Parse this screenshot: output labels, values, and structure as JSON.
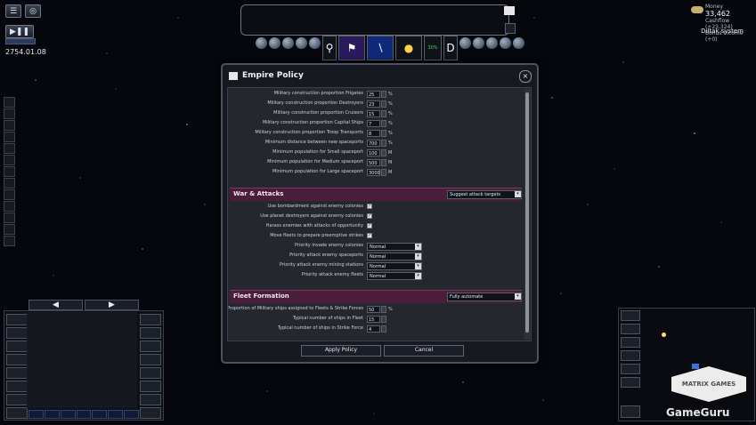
{
  "top_left": {
    "date": "2754.01.08",
    "play_symbol": "▶❚❚"
  },
  "top_right": {
    "money_label": "Money",
    "money_value": "33,462",
    "cashflow_label": "Cashflow",
    "cashflow_value": "(+23,324)",
    "bonus_label": "Bonus Income",
    "bonus_value": "(+0)",
    "system_name": "Diltak system"
  },
  "toolbar": {
    "research_label": "30%"
  },
  "dialog": {
    "title": "Empire Policy",
    "close_symbol": "×",
    "construction": [
      {
        "label": "Military construction proportion Frigates",
        "value": "25",
        "unit": "%"
      },
      {
        "label": "Military construction proportion Destroyers",
        "value": "23",
        "unit": "%"
      },
      {
        "label": "Military construction proportion Cruisers",
        "value": "15",
        "unit": "%"
      },
      {
        "label": "Military construction proportion Capital Ships",
        "value": "7",
        "unit": "%"
      },
      {
        "label": "Military construction proportion Troop Transports",
        "value": "8",
        "unit": "%"
      },
      {
        "label": "Minimum distance between new spaceports",
        "value": "700",
        "unit": "%"
      },
      {
        "label": "Minimum population for Small spaceport",
        "value": "100",
        "unit": "M"
      },
      {
        "label": "Minimum population for Medium spaceport",
        "value": "500",
        "unit": "M"
      },
      {
        "label": "Minimum population for Large spaceport",
        "value": "3000",
        "unit": "M"
      }
    ],
    "war": {
      "title": "War & Attacks",
      "select": "Suggest attack targets",
      "checks": [
        {
          "label": "Use bombardment against enemy colonies",
          "mark": "✓"
        },
        {
          "label": "Use planet destroyers against enemy colonies",
          "mark": "✓"
        },
        {
          "label": "Harass enemies with attacks of opportunity",
          "mark": "✓"
        },
        {
          "label": "Move fleets to prepare preemptive strikes",
          "mark": "✓"
        }
      ],
      "priorities": [
        {
          "label": "Priority invade enemy colonies",
          "value": "Normal"
        },
        {
          "label": "Priority attack enemy spaceports",
          "value": "Normal"
        },
        {
          "label": "Priority attack enemy mining stations",
          "value": "Normal"
        },
        {
          "label": "Priority attack enemy fleets",
          "value": "Normal"
        }
      ]
    },
    "fleet": {
      "title": "Fleet Formation",
      "select": "Fully automate",
      "rows": [
        {
          "label": "Proportion of Military ships assigned to Fleets & Strike Forces",
          "value": "50",
          "unit": "%"
        },
        {
          "label": "Typical number of ships in Fleet",
          "value": "15",
          "unit": ""
        },
        {
          "label": "Typical number of ships in Strike Force",
          "value": "4",
          "unit": ""
        }
      ]
    },
    "apply_label": "Apply Policy",
    "cancel_label": "Cancel"
  },
  "bottom_left": {
    "prev_symbol": "◀",
    "next_symbol": "▶"
  },
  "logo_text": "MATRIX GAMES",
  "watermark": "GameGuru"
}
